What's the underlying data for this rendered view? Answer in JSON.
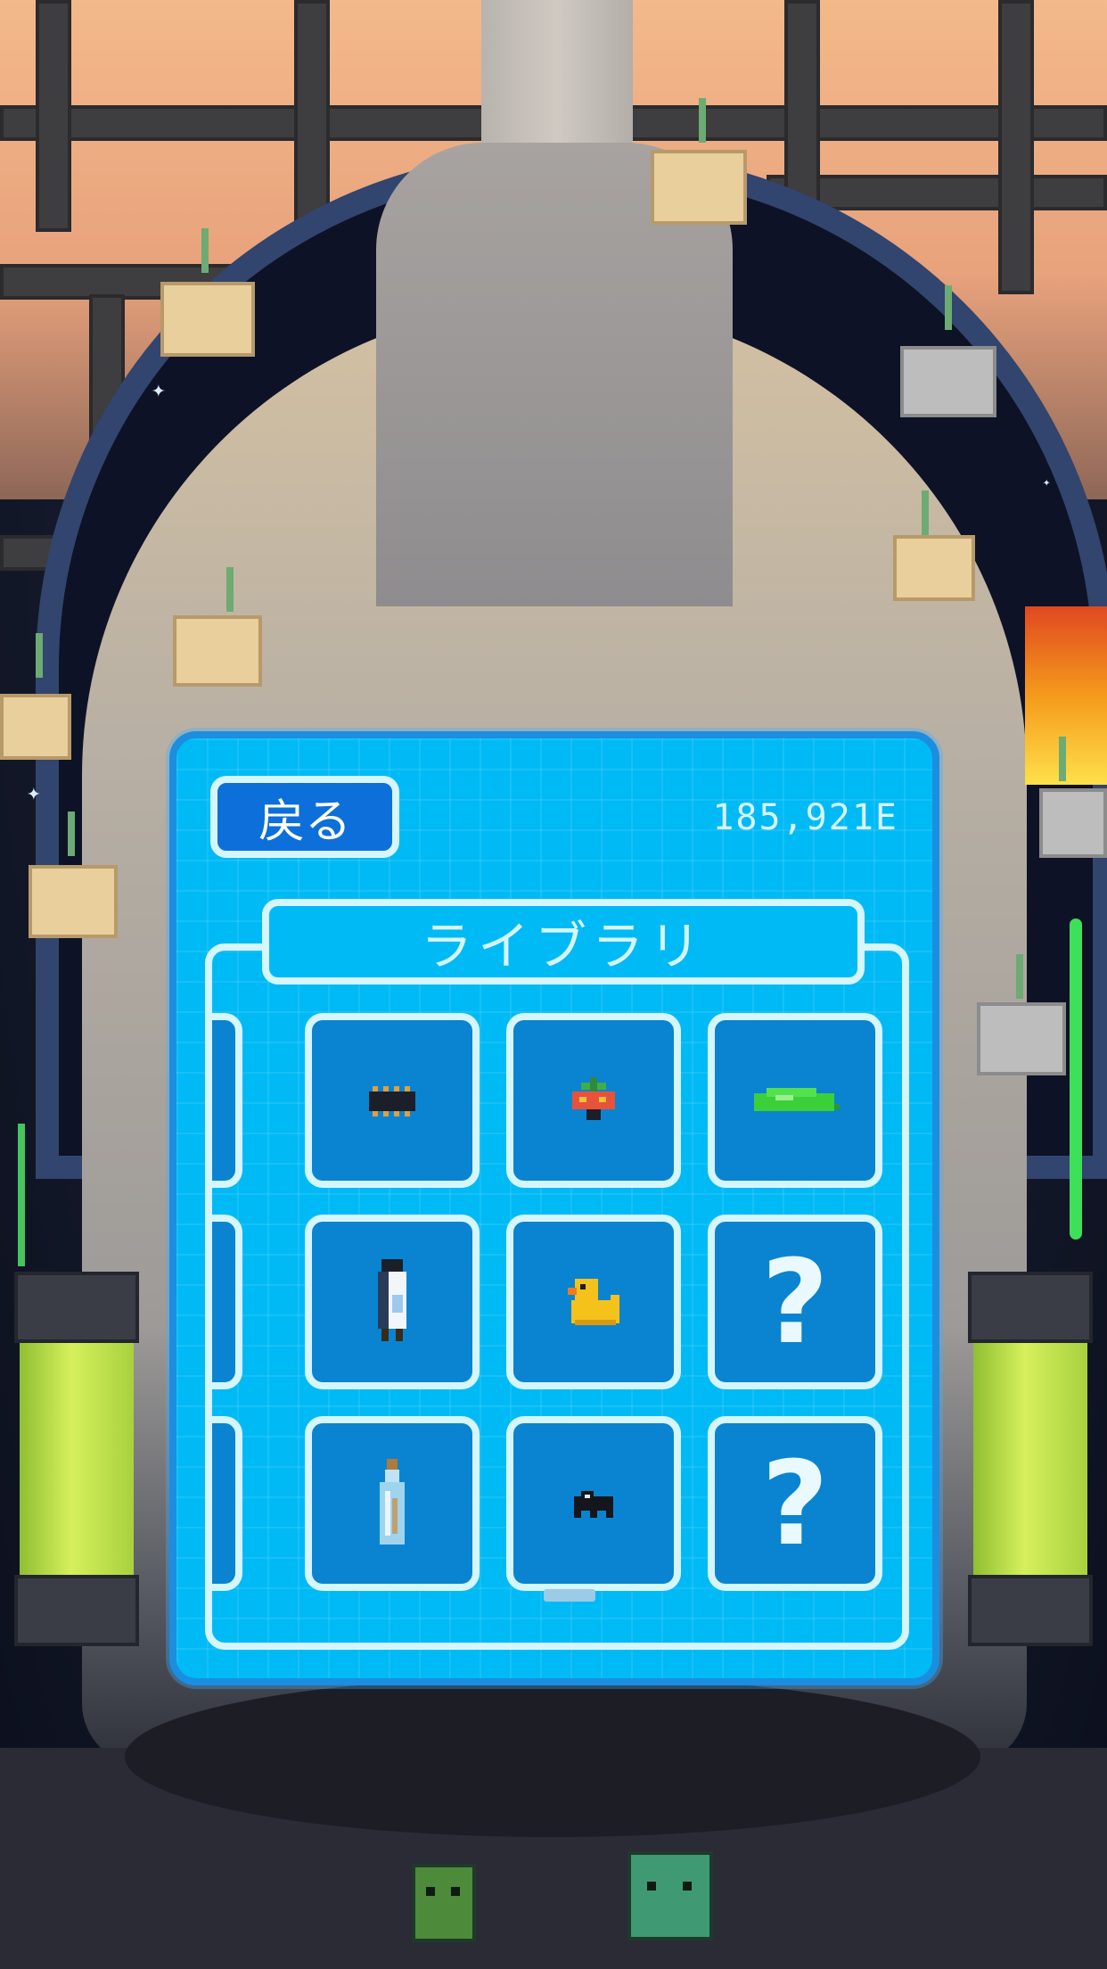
{
  "header": {
    "back_label": "戻る",
    "currency": "185,921E"
  },
  "library": {
    "title": "ライブラリ",
    "slots": [
      {
        "icon": "chip-icon",
        "unlocked": true
      },
      {
        "icon": "potted-plant-icon",
        "unlocked": true
      },
      {
        "icon": "green-slime-icon",
        "unlocked": true
      },
      {
        "icon": "milk-carton-icon",
        "unlocked": true
      },
      {
        "icon": "rubber-duck-icon",
        "unlocked": true
      },
      {
        "icon": "unknown-item-icon",
        "unlocked": false,
        "label": "?"
      },
      {
        "icon": "bottle-icon",
        "unlocked": true
      },
      {
        "icon": "black-bug-icon",
        "unlocked": true
      },
      {
        "icon": "unknown-item-icon",
        "unlocked": false,
        "label": "?"
      }
    ]
  },
  "colors": {
    "panel": "#00baf6",
    "panel_border": "#1b8ee0",
    "cell": "#0a84d0",
    "outline": "#d6f6ff",
    "back_button": "#0d6fd9"
  }
}
